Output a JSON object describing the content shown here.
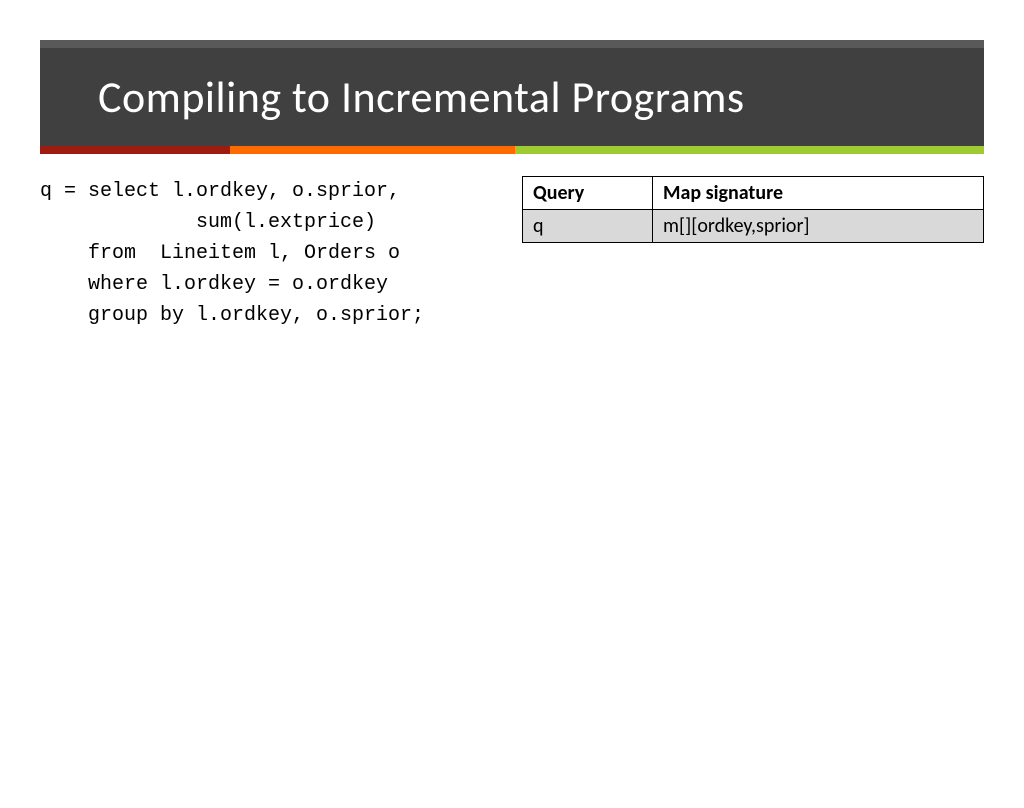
{
  "title": "Compiling to Incremental Programs",
  "code": {
    "line1": "q = select l.ordkey, o.sprior,",
    "line2": "             sum(l.extprice)",
    "line3": "    from  Lineitem l, Orders o",
    "line4": "    where l.ordkey = o.ordkey",
    "line5": "    group by l.ordkey, o.sprior;"
  },
  "table": {
    "header_query": "Query",
    "header_sig": "Map signature",
    "row1_query": "q",
    "row1_sig": "m[][ordkey,sprior]"
  }
}
